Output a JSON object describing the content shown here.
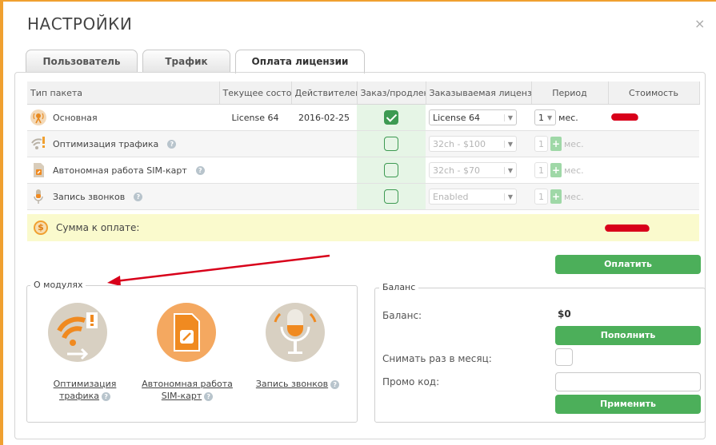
{
  "dialog": {
    "title": "НАСТРОЙКИ",
    "close_label": "×"
  },
  "tabs": [
    {
      "label": "Пользователь"
    },
    {
      "label": "Трафик"
    },
    {
      "label": "Оплата лицензии"
    }
  ],
  "table": {
    "headers": [
      "Тип пакета",
      "Текущее состо",
      "Действителен",
      "Заказ/продлен",
      "Заказываемая лицензи",
      "Период",
      "Стоимость"
    ],
    "rows": [
      {
        "name": "Основная",
        "current": "License 64",
        "valid": "2016-02-25",
        "checked": true,
        "license": "License 64",
        "period": "1",
        "unit": "мес.",
        "disabled": false
      },
      {
        "name": "Оптимизация трафика",
        "current": "",
        "valid": "",
        "checked": false,
        "license": "32ch - $100",
        "period": "1",
        "unit": "мес.",
        "disabled": true
      },
      {
        "name": "Автономная работа SIM-карт",
        "current": "",
        "valid": "",
        "checked": false,
        "license": "32ch - $70",
        "period": "1",
        "unit": "мес.",
        "disabled": true
      },
      {
        "name": "Запись звонков",
        "current": "",
        "valid": "",
        "checked": false,
        "license": "Enabled",
        "period": "1",
        "unit": "мес.",
        "disabled": true
      }
    ],
    "help_glyph": "?",
    "plus_glyph": "+",
    "arrow_glyph": "▼"
  },
  "summary": {
    "label": "Сумма к оплате:",
    "icon_glyph": "$"
  },
  "pay_button": "Оплатить",
  "modules": {
    "legend": "О модулях",
    "items": [
      {
        "line1": "Оптимизация",
        "line2": "трафика"
      },
      {
        "line1": "Автономная работа",
        "line2": "SIM-карт"
      },
      {
        "line1": "Запись звонков",
        "line2": ""
      }
    ]
  },
  "balance": {
    "legend": "Баланс",
    "balance_label": "Баланс:",
    "balance_value": "$0",
    "topup_button": "Пополнить",
    "monthly_label": "Снимать раз в месяц:",
    "promo_label": "Промо код:",
    "apply_button": "Применить"
  },
  "colors": {
    "accent": "#4caf5a",
    "frame": "#f0a030",
    "summary_bg": "#fafacd",
    "annotation": "#d8001a"
  }
}
